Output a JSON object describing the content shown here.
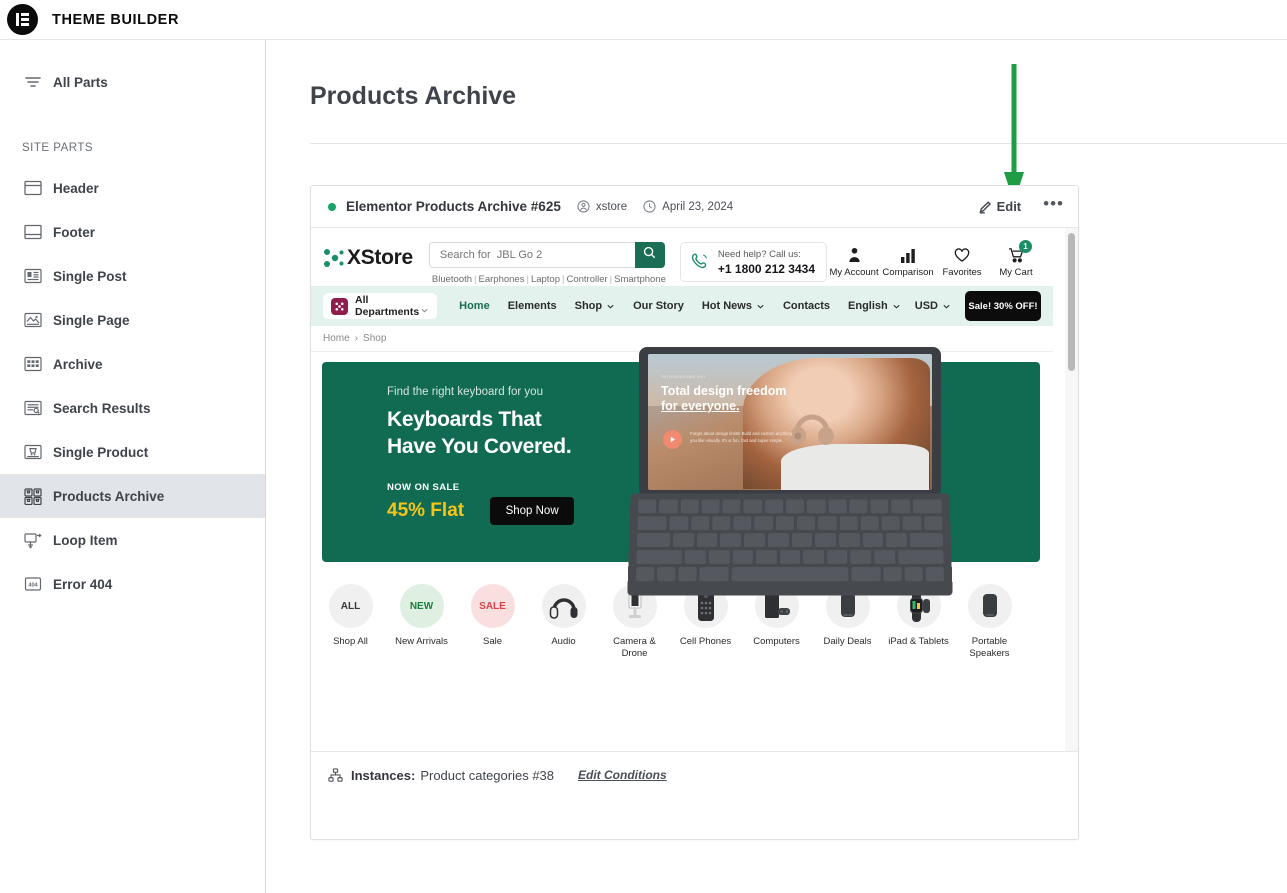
{
  "app": {
    "title": "THEME BUILDER",
    "logo_icon": "elementor-logo-icon"
  },
  "sidebar": {
    "all_parts": {
      "label": "All Parts",
      "icon": "filter-lines-icon"
    },
    "section_label": "SITE PARTS",
    "items": [
      {
        "label": "Header",
        "icon": "header-layout-icon",
        "active": false
      },
      {
        "label": "Footer",
        "icon": "footer-layout-icon",
        "active": false
      },
      {
        "label": "Single Post",
        "icon": "single-post-icon",
        "active": false
      },
      {
        "label": "Single Page",
        "icon": "single-page-icon",
        "active": false
      },
      {
        "label": "Archive",
        "icon": "archive-grid-icon",
        "active": false
      },
      {
        "label": "Search Results",
        "icon": "search-results-icon",
        "active": false
      },
      {
        "label": "Single Product",
        "icon": "single-product-icon",
        "active": false
      },
      {
        "label": "Products Archive",
        "icon": "products-archive-icon",
        "active": true
      },
      {
        "label": "Loop Item",
        "icon": "loop-item-icon",
        "active": false
      },
      {
        "label": "Error 404",
        "icon": "error-404-icon",
        "active": false
      }
    ]
  },
  "main": {
    "page_title": "Products Archive"
  },
  "card": {
    "status_dot_color": "#17a464",
    "name": "Elementor Products Archive #625",
    "author_icon": "user-circle-icon",
    "author": "xstore",
    "date_icon": "clock-icon",
    "date": "April 23, 2024",
    "edit_icon": "pencil-icon",
    "edit_label": "Edit",
    "more_label": "•••",
    "footer": {
      "instances_icon": "sitemap-icon",
      "instances_label": "Instances:",
      "instances_value": "Product categories #38",
      "edit_conditions_label": "Edit Conditions"
    }
  },
  "annotation": {
    "arrow_color": "#1f9d45",
    "points_to": "edit-button"
  },
  "preview": {
    "store": {
      "logo_text": "XStore",
      "logo_mark_color": "#1a8f63",
      "search": {
        "value": "Search for  JBL Go 2",
        "placeholder": "Search for  JBL Go 2",
        "button_icon": "search-icon",
        "button_color": "#1a6e55"
      },
      "search_tags": [
        "Bluetooth",
        "Earphones",
        "Laptop",
        "Controller",
        "Smartphone"
      ],
      "call_us": {
        "icon": "phone-icon",
        "label": "Need help? Call us:",
        "number": "+1 1800 212 3434"
      },
      "account_items": [
        {
          "label": "My Account",
          "icon": "user-icon",
          "badge": null
        },
        {
          "label": "Comparison",
          "icon": "bar-chart-icon",
          "badge": null
        },
        {
          "label": "Favorites",
          "icon": "heart-icon",
          "badge": null
        },
        {
          "label": "My Cart",
          "icon": "cart-icon",
          "badge": "1"
        }
      ]
    },
    "nav": {
      "background": "#e3f2ec",
      "departments": {
        "label": "All Departments",
        "icon": "grid-dots-icon",
        "icon_color": "#8e1f4d"
      },
      "links": [
        {
          "label": "Home",
          "has_chevron": false,
          "active": true
        },
        {
          "label": "Elements",
          "has_chevron": false,
          "active": false
        },
        {
          "label": "Shop",
          "has_chevron": true,
          "active": false
        },
        {
          "label": "Our Story",
          "has_chevron": false,
          "active": false
        },
        {
          "label": "Hot News",
          "has_chevron": true,
          "active": false
        },
        {
          "label": "Contacts",
          "has_chevron": false,
          "active": false
        }
      ],
      "language": "English",
      "currency": "USD",
      "sale_button": "Sale! 30% OFF!"
    },
    "breadcrumb": {
      "items": [
        "Home",
        "Shop"
      ],
      "separator": "›"
    },
    "hero": {
      "background": "#116b52",
      "kicker": "Find the right keyboard for you",
      "headline_line1": "Keyboards That",
      "headline_line2": "Have You Covered.",
      "sale_label": "NOW ON SALE",
      "discount": "45% Flat",
      "discount_color": "#f5c518",
      "cta": "Shop Now",
      "device_screen": {
        "kicker": "INTRODUCING H9i",
        "title_line1": "Total design freedom",
        "title_line2": "for everyone.",
        "body": "Forget about design limits! Build and custom anything you like visually. It's is fun, fast and super simple."
      }
    },
    "categories": [
      {
        "label": "Shop All",
        "badge": "ALL",
        "style": "all"
      },
      {
        "label": "New Arrivals",
        "badge": "NEW",
        "style": "new"
      },
      {
        "label": "Sale",
        "badge": "SALE",
        "style": "sale"
      },
      {
        "label": "Audio",
        "badge": "",
        "style": "image",
        "thumb": "headphones"
      },
      {
        "label": "Camera & Drone",
        "badge": "",
        "style": "image",
        "thumb": "camera"
      },
      {
        "label": "Cell Phones",
        "badge": "",
        "style": "image",
        "thumb": "phone"
      },
      {
        "label": "Computers",
        "badge": "",
        "style": "image",
        "thumb": "console"
      },
      {
        "label": "Daily Deals",
        "badge": "",
        "style": "image",
        "thumb": "speaker"
      },
      {
        "label": "iPad & Tablets",
        "badge": "",
        "style": "image",
        "thumb": "watch"
      },
      {
        "label": "Portable Speakers",
        "badge": "",
        "style": "image",
        "thumb": "speaker2"
      }
    ],
    "scrollbar": {
      "visible": true
    }
  }
}
